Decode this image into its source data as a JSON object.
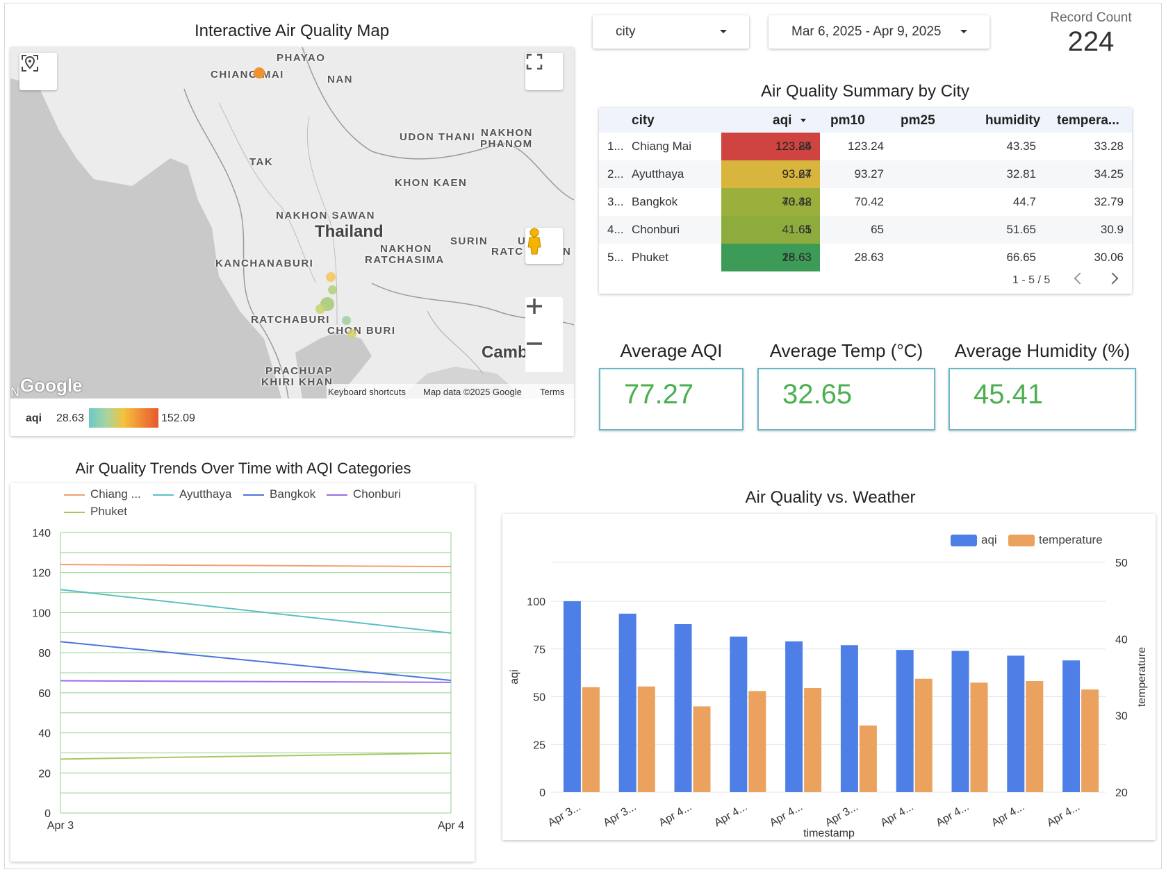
{
  "map": {
    "title": "Interactive Air Quality Map",
    "places": [
      {
        "name": "PHAYAO"
      },
      {
        "name": "CHIANG MAI"
      },
      {
        "name": "NAN"
      },
      {
        "name": "UDON THANI"
      },
      {
        "name": "NAKHON"
      },
      {
        "name": "PHANOM"
      },
      {
        "name": "TAK"
      },
      {
        "name": "KHON KAEN"
      },
      {
        "name": "NAKHON SAWAN"
      },
      {
        "name": "Thailand"
      },
      {
        "name": "NAKHON"
      },
      {
        "name": "RATCHASIMA"
      },
      {
        "name": "SURIN"
      },
      {
        "name": "U"
      },
      {
        "name": "RATC"
      },
      {
        "name": "N"
      },
      {
        "name": "KANCHANABURI"
      },
      {
        "name": "RATCHABURI"
      },
      {
        "name": "CHON BURI"
      },
      {
        "name": "PRACHUAP"
      },
      {
        "name": "KHIRI KHAN"
      },
      {
        "name": "Camb"
      }
    ],
    "google_logo": "Google",
    "left_edge": "N",
    "keyboard_shortcuts": "Keyboard shortcuts",
    "map_data": "Map data ©2025 Google",
    "terms": "Terms",
    "legend": {
      "field": "aqi",
      "min": "28.63",
      "max": "152.09"
    },
    "colors": {
      "ramp_start": "#6cc9c8",
      "ramp_mid": "#f5c23c",
      "ramp_end": "#e8582c"
    },
    "icons": {
      "locate": "location-icon",
      "fullscreen": "fullscreen-icon",
      "pegman": "pegman-icon",
      "zoom_in": "plus-icon",
      "zoom_out": "minus-icon"
    },
    "markers": [
      {
        "label": "Chiang Mai",
        "aqi": 123.24,
        "color": "#f0922e"
      },
      {
        "label": "Ayutthaya",
        "aqi": 93.27,
        "color": "#f5c75a"
      },
      {
        "label": "Bangkok",
        "aqi": 70.42,
        "color": "#b3d07a"
      },
      {
        "label": "Chonburi",
        "aqi": 65,
        "color": "#d3d168"
      },
      {
        "label": "Phuket",
        "aqi": 28.63,
        "color": "#9fd0a3"
      }
    ]
  },
  "filters": {
    "city": "city",
    "date_range": "Mar 6, 2025 - Apr 9, 2025"
  },
  "record_count": {
    "label": "Record Count",
    "value": "224"
  },
  "summary": {
    "title": "Air Quality Summary by City",
    "columns": [
      "city",
      "aqi",
      "pm10",
      "pm25",
      "humidity",
      "tempera..."
    ],
    "rows": [
      {
        "idx": "1...",
        "city": "Chiang Mai",
        "aqi": "123.24",
        "pm10": "85",
        "pm25": "123.24",
        "humidity": "43.35",
        "temperature": "33.28",
        "color": "#cf4340"
      },
      {
        "idx": "2...",
        "city": "Ayutthaya",
        "aqi": "93.27",
        "pm10": "64",
        "pm25": "93.27",
        "humidity": "32.81",
        "temperature": "34.25",
        "color": "#d8b53c"
      },
      {
        "idx": "3...",
        "city": "Bangkok",
        "aqi": "70.42",
        "pm10": "43.38",
        "pm25": "70.42",
        "humidity": "44.7",
        "temperature": "32.79",
        "color": "#9aaf3c"
      },
      {
        "idx": "4...",
        "city": "Chonburi",
        "aqi": "65",
        "pm10": "41.61",
        "pm25": "65",
        "humidity": "51.65",
        "temperature": "30.9",
        "color": "#8eab3e"
      },
      {
        "idx": "5...",
        "city": "Phuket",
        "aqi": "28.63",
        "pm10": "15.63",
        "pm25": "28.63",
        "humidity": "66.65",
        "temperature": "30.06",
        "color": "#3c9c57"
      }
    ],
    "pagination": "1 - 5 / 5"
  },
  "kpis": [
    {
      "title": "Average AQI",
      "value": "77.27"
    },
    {
      "title": "Average Temp (°C)",
      "value": "32.65"
    },
    {
      "title": "Average Humidity (%)",
      "value": "45.41"
    }
  ],
  "chart_data": [
    {
      "type": "line",
      "title": "Air Quality Trends Over Time with AQI Categories",
      "x": [
        "Apr 3",
        "Apr 4"
      ],
      "ylim": [
        0,
        140
      ],
      "yticks": [
        0,
        20,
        40,
        60,
        80,
        100,
        120,
        140
      ],
      "grid": true,
      "legend": "top-left",
      "series": [
        {
          "name": "Chiang ...",
          "color": "#f0a070",
          "values": [
            124,
            123
          ]
        },
        {
          "name": "Ayutthaya",
          "color": "#5bbfc4",
          "values": [
            111.5,
            89.8
          ]
        },
        {
          "name": "Bangkok",
          "color": "#4d73e0",
          "values": [
            85.5,
            66.2
          ]
        },
        {
          "name": "Chonburi",
          "color": "#9a6ee6",
          "values": [
            66,
            65.2
          ]
        },
        {
          "name": "Phuket",
          "color": "#a7c860",
          "values": [
            26.9,
            29.9
          ]
        }
      ]
    },
    {
      "type": "bar",
      "title": "Air Quality vs. Weather",
      "xlabel": "timestamp",
      "ylabel": "aqi",
      "y2label": "temperature",
      "categories": [
        "Apr 3...",
        "Apr 3...",
        "Apr 4...",
        "Apr 4...",
        "Apr 4...",
        "Apr 3...",
        "Apr 4...",
        "Apr 4...",
        "Apr 4...",
        "Apr 4..."
      ],
      "ylim": [
        0,
        100
      ],
      "yticks": [
        0,
        25,
        50,
        75,
        100
      ],
      "y2lim": [
        20,
        50
      ],
      "y2ticks": [
        20,
        30,
        40,
        50
      ],
      "legend": "top-right",
      "series": [
        {
          "name": "aqi",
          "color": "#4d7fe6",
          "axis": "left",
          "values": [
            100,
            93.5,
            88,
            81.5,
            79,
            77,
            74.5,
            74,
            71.5,
            69
          ]
        },
        {
          "name": "temperature",
          "color": "#eba25e",
          "axis": "right",
          "values": [
            33.7,
            33.8,
            31.2,
            33.2,
            33.6,
            28.7,
            34.8,
            34.3,
            34.5,
            33.4
          ]
        }
      ]
    }
  ]
}
